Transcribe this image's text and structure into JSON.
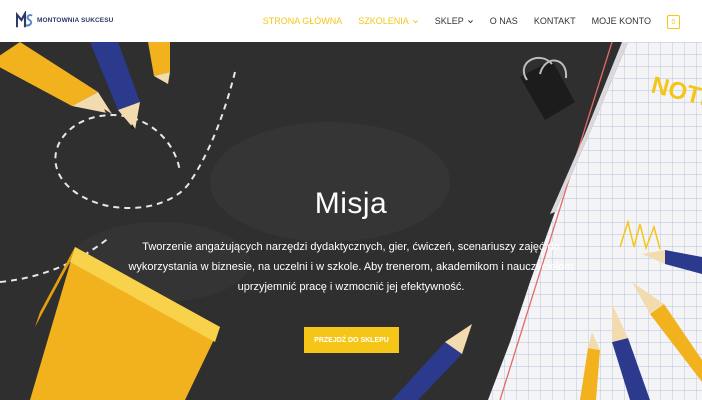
{
  "brand": {
    "name": "MONTOWNIA SUKCESU",
    "logo_icon": "ms-logo-icon",
    "colors": {
      "accent": "#f5c518",
      "navy": "#2b3a67",
      "board": "#2f2f2f"
    }
  },
  "nav": {
    "items": [
      {
        "label": "STRONA GŁÓWNA",
        "active": true,
        "dropdown": false
      },
      {
        "label": "SZKOLENIA",
        "active": true,
        "dropdown": true
      },
      {
        "label": "SKLEP",
        "active": false,
        "dropdown": true
      },
      {
        "label": "O NAS",
        "active": false,
        "dropdown": false
      },
      {
        "label": "KONTAKT",
        "active": false,
        "dropdown": false
      },
      {
        "label": "MOJE KONTO",
        "active": false,
        "dropdown": false
      }
    ],
    "cart_count": "0"
  },
  "hero": {
    "title": "Misja",
    "text": "Tworzenie angażujących narzędzi dydaktycznych, gier, ćwiczeń, scenariuszy zajęć do wykorzystania w biznesie, na uczelni i w szkole. Aby trenerom, akademikom i nauczycielom uprzyjemnić pracę i wzmocnić jej efektywność.",
    "cta_label": "PRZEJDŹ DO SKLEPU",
    "notebook_word": "NOTE"
  }
}
